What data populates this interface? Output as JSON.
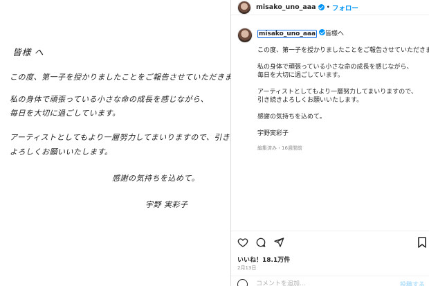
{
  "letter": {
    "greeting": "皆様 へ",
    "lines": [
      "この度、第一子を授かりましたことをご報告させていただきます。",
      "私の身体で頑張っている小さな命の成長を感じながら、",
      "毎日を大切に過ごしています。",
      "アーティストとしてもより一層努力してまいりますので、引き続き",
      "よろしくお願いいたします。",
      "感謝の気持ちを込めて。",
      "宇野 実彩子"
    ]
  },
  "post": {
    "header": {
      "username": "misako_uno_aaa",
      "separator": "•",
      "follow_label": "フォロー"
    },
    "caption": {
      "username": "misako_uno_aaa",
      "first_line_suffix": "皆様へ",
      "paragraphs": [
        [
          "この度、第一子を授かりましたことをご報告させていただきます。"
        ],
        [
          "私の身体で頑張っている小さな命の成長を感じながら、",
          "毎日を大切に過ごしています。"
        ],
        [
          "アーティストとしてもより一層努力してまいりますので、",
          "引き続きよろしくお願いいたします。"
        ],
        [
          "感謝の気持ちを込めて。"
        ],
        [
          "宇野実彩子"
        ]
      ],
      "meta": "編集済み・16週間前"
    },
    "likes": "いいね！18.1万件",
    "date": "2月13日",
    "comment_placeholder": "コメントを追加...",
    "post_label": "投稿する"
  },
  "icons": {
    "like": "heart-icon",
    "comment": "comment-icon",
    "share": "share-icon",
    "save": "bookmark-icon",
    "emoji": "emoji-icon"
  },
  "colors": {
    "accent": "#0095f6",
    "highlight_border": "#1a73e8",
    "muted": "#8e8e8e"
  }
}
